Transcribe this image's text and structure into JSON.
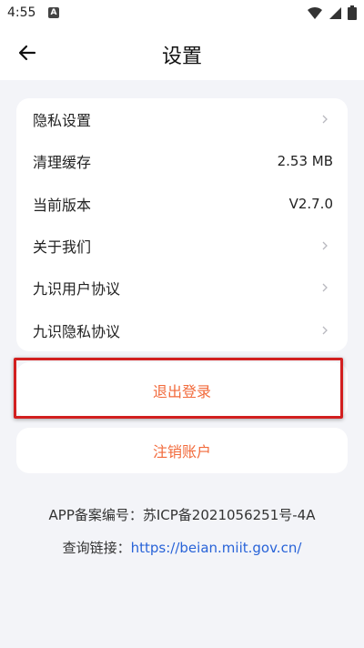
{
  "status_bar": {
    "time": "4:55",
    "notification_letter": "A"
  },
  "header": {
    "title": "设置"
  },
  "settings": {
    "items": [
      {
        "label": "隐私设置",
        "value": "",
        "icon": "chevron-right-icon"
      },
      {
        "label": "清理缓存",
        "value": "2.53 MB",
        "icon": ""
      },
      {
        "label": "当前版本",
        "value": "V2.7.0",
        "icon": ""
      },
      {
        "label": "关于我们",
        "value": "",
        "icon": "chevron-right-icon"
      },
      {
        "label": "九识用户协议",
        "value": "",
        "icon": "chevron-right-icon"
      },
      {
        "label": "九识隐私协议",
        "value": "",
        "icon": "chevron-right-icon"
      }
    ]
  },
  "actions": {
    "logout_label": "退出登录",
    "cancel_account_label": "注销账户"
  },
  "filing": {
    "record_text": "APP备案编号：苏ICP备2021056251号-4A",
    "query_prefix": "查询链接：",
    "query_url": "https://beian.miit.gov.cn/"
  },
  "colors": {
    "accent_orange": "#f26a3b",
    "link_blue": "#2863d8",
    "highlight_red": "#d21f1f",
    "page_background": "#f3f4f8"
  }
}
